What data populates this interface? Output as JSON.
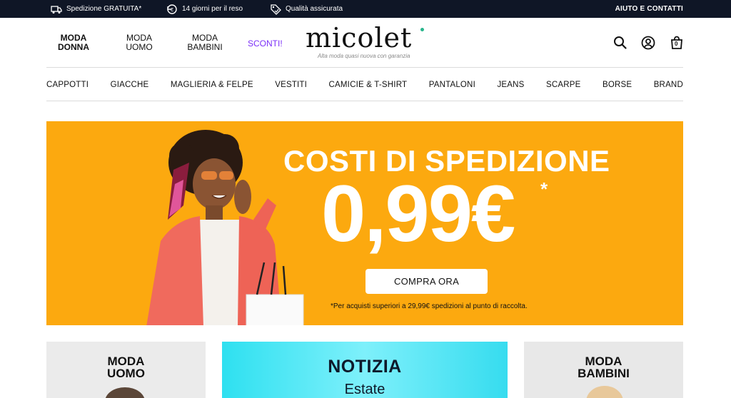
{
  "topbar": {
    "perks": [
      {
        "icon": "truck-icon",
        "label": "Spedizione GRATUITA*"
      },
      {
        "icon": "return-icon",
        "label": "14 giorni per il reso"
      },
      {
        "icon": "tag-check-icon",
        "label": "Qualità assicurata"
      }
    ],
    "help": "AIUTO E CONTATTI"
  },
  "header": {
    "genders": [
      {
        "label": "MODA DONNA",
        "line1": "MODA",
        "line2": "DONNA",
        "active": true
      },
      {
        "label": "MODA UOMO",
        "line1": "MODA",
        "line2": "UOMO",
        "active": false
      },
      {
        "label": "MODA BAMBINI",
        "line1": "MODA",
        "line2": "BAMBINI",
        "active": false
      }
    ],
    "sconti": "SCONTI!",
    "logo": {
      "word": "micolet",
      "tagline": "Alta moda quasi nuova con garanzia"
    },
    "icons": [
      "search-icon",
      "account-icon",
      "cart-icon"
    ],
    "cart_count": "0"
  },
  "categories": [
    "CAPPOTTI",
    "GIACCHE",
    "MAGLIERIA & FELPE",
    "VESTITI",
    "CAMICIE & T-SHIRT",
    "PANTALONI",
    "JEANS",
    "SCARPE",
    "BORSE",
    "BRAND"
  ],
  "hero": {
    "headline": "COSTI DI SPEDIZIONE",
    "price": "0,99€",
    "star": "*",
    "cta": "COMPRA ORA",
    "note": "*Per acquisti superiori a 29,99€ spedizioni al punto di raccolta.",
    "bg_color": "#fca90f"
  },
  "tiles": [
    {
      "line1": "MODA",
      "line2": "UOMO"
    },
    {
      "title": "NOTIZIA",
      "subtitle": "Estate"
    },
    {
      "line1": "MODA",
      "line2": "BAMBINI"
    }
  ],
  "colors": {
    "topbar": "#0f1626",
    "accent": "#7b2ff7",
    "logo_dot": "#28b58c"
  }
}
